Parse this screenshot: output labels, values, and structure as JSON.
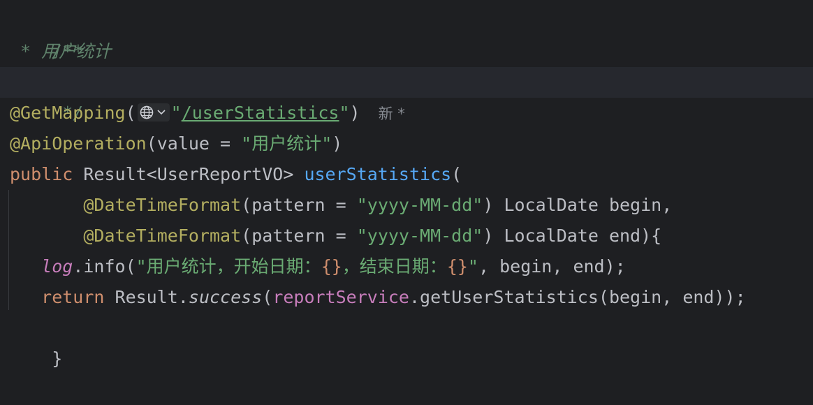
{
  "editor": {
    "lines": {
      "l1": {
        "text": "/**"
      },
      "l2": {
        "prefix": " * ",
        "text": "用户统计"
      },
      "l3": {
        "text": " */"
      },
      "l4": {
        "annotation": "@GetMapping",
        "open": "(",
        "quote_open": "\"",
        "path": "/userStatistics",
        "quote_close": "\"",
        "close": ")",
        "hint": "新 *"
      },
      "l5": {
        "annotation": "@ApiOperation",
        "open": "(value = ",
        "value": "\"用户统计\"",
        "close": ")"
      },
      "l6": {
        "keyword": "public",
        "type": " Result<UserReportVO> ",
        "method": "userStatistics",
        "open": "("
      },
      "l7": {
        "indent": "       ",
        "annotation": "@DateTimeFormat",
        "open": "(pattern = ",
        "value": "\"yyyy-MM-dd\"",
        "rest": ") LocalDate begin,"
      },
      "l8": {
        "indent": "       ",
        "annotation": "@DateTimeFormat",
        "open": "(pattern = ",
        "value": "\"yyyy-MM-dd\"",
        "rest": ") LocalDate end){"
      },
      "l9": {
        "indent": "   ",
        "field": "log",
        "call": ".info(",
        "str1": "\"用户统计，开始日期：",
        "brace1": "{}",
        "str2": "，结束日期：",
        "brace2": "{}",
        "str3": "\"",
        "rest": ", begin, end);"
      },
      "l10": {
        "indent": "   ",
        "keyword": "return",
        "cls": " Result.",
        "method": "success",
        "open": "(",
        "field": "reportService",
        "rest": ".getUserStatistics(begin, end));"
      },
      "l11": {
        "text": "}"
      }
    }
  },
  "icons": {
    "globe": "globe-icon",
    "chevron": "chevron-down-icon"
  },
  "colors": {
    "background": "#1e1f22",
    "current_line": "#26282e",
    "comment": "#5f826b",
    "annotation": "#b3ae60",
    "keyword": "#cf8e6d",
    "string": "#6aab73",
    "method_decl": "#56a8f5",
    "field": "#c77dbb",
    "plain": "#bcbec4"
  }
}
